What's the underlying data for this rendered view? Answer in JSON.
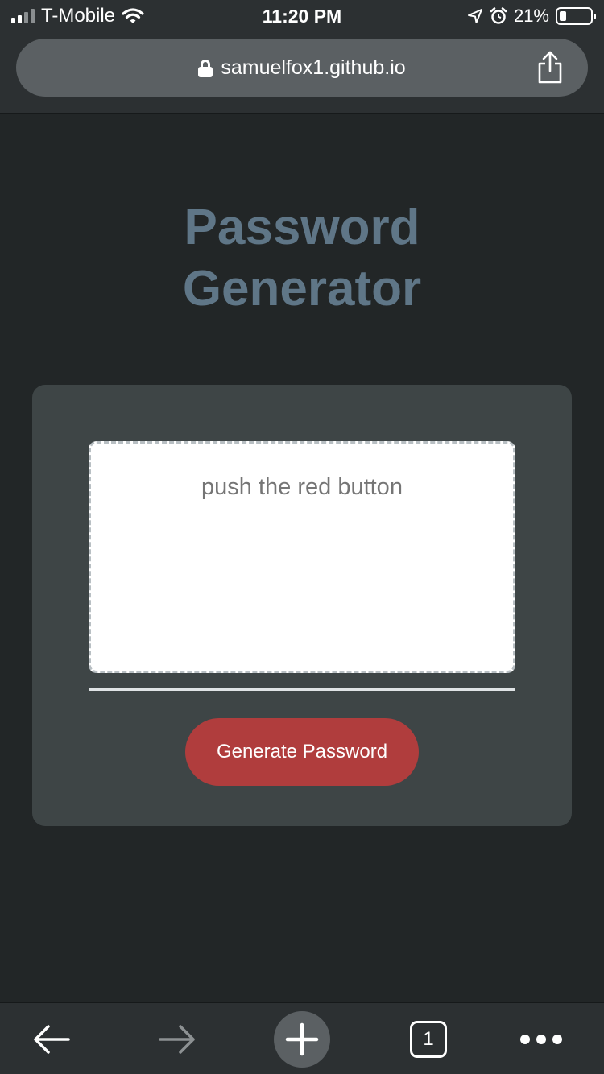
{
  "status_bar": {
    "carrier": "T-Mobile",
    "time": "11:20 PM",
    "battery_percent": "21%",
    "battery_level": 0.21,
    "icons": [
      "signal-icon",
      "wifi-icon",
      "location-icon",
      "alarm-icon",
      "battery-icon"
    ]
  },
  "browser": {
    "url": "samuelfox1.github.io",
    "icons": [
      "lock-icon",
      "share-icon"
    ],
    "toolbar": {
      "tab_count": "1",
      "icons": [
        "back-arrow-icon",
        "forward-arrow-icon",
        "new-tab-plus-icon",
        "tabs-icon",
        "more-options-icon"
      ]
    }
  },
  "page": {
    "title_line1": "Password",
    "title_line2": "Generator",
    "password_placeholder": "push the red button",
    "generate_button_label": "Generate Password"
  },
  "colors": {
    "background": "#222627",
    "card": "#3e4546",
    "title": "#5f7687",
    "button": "#b03d3d",
    "chrome": "#2c3032"
  }
}
